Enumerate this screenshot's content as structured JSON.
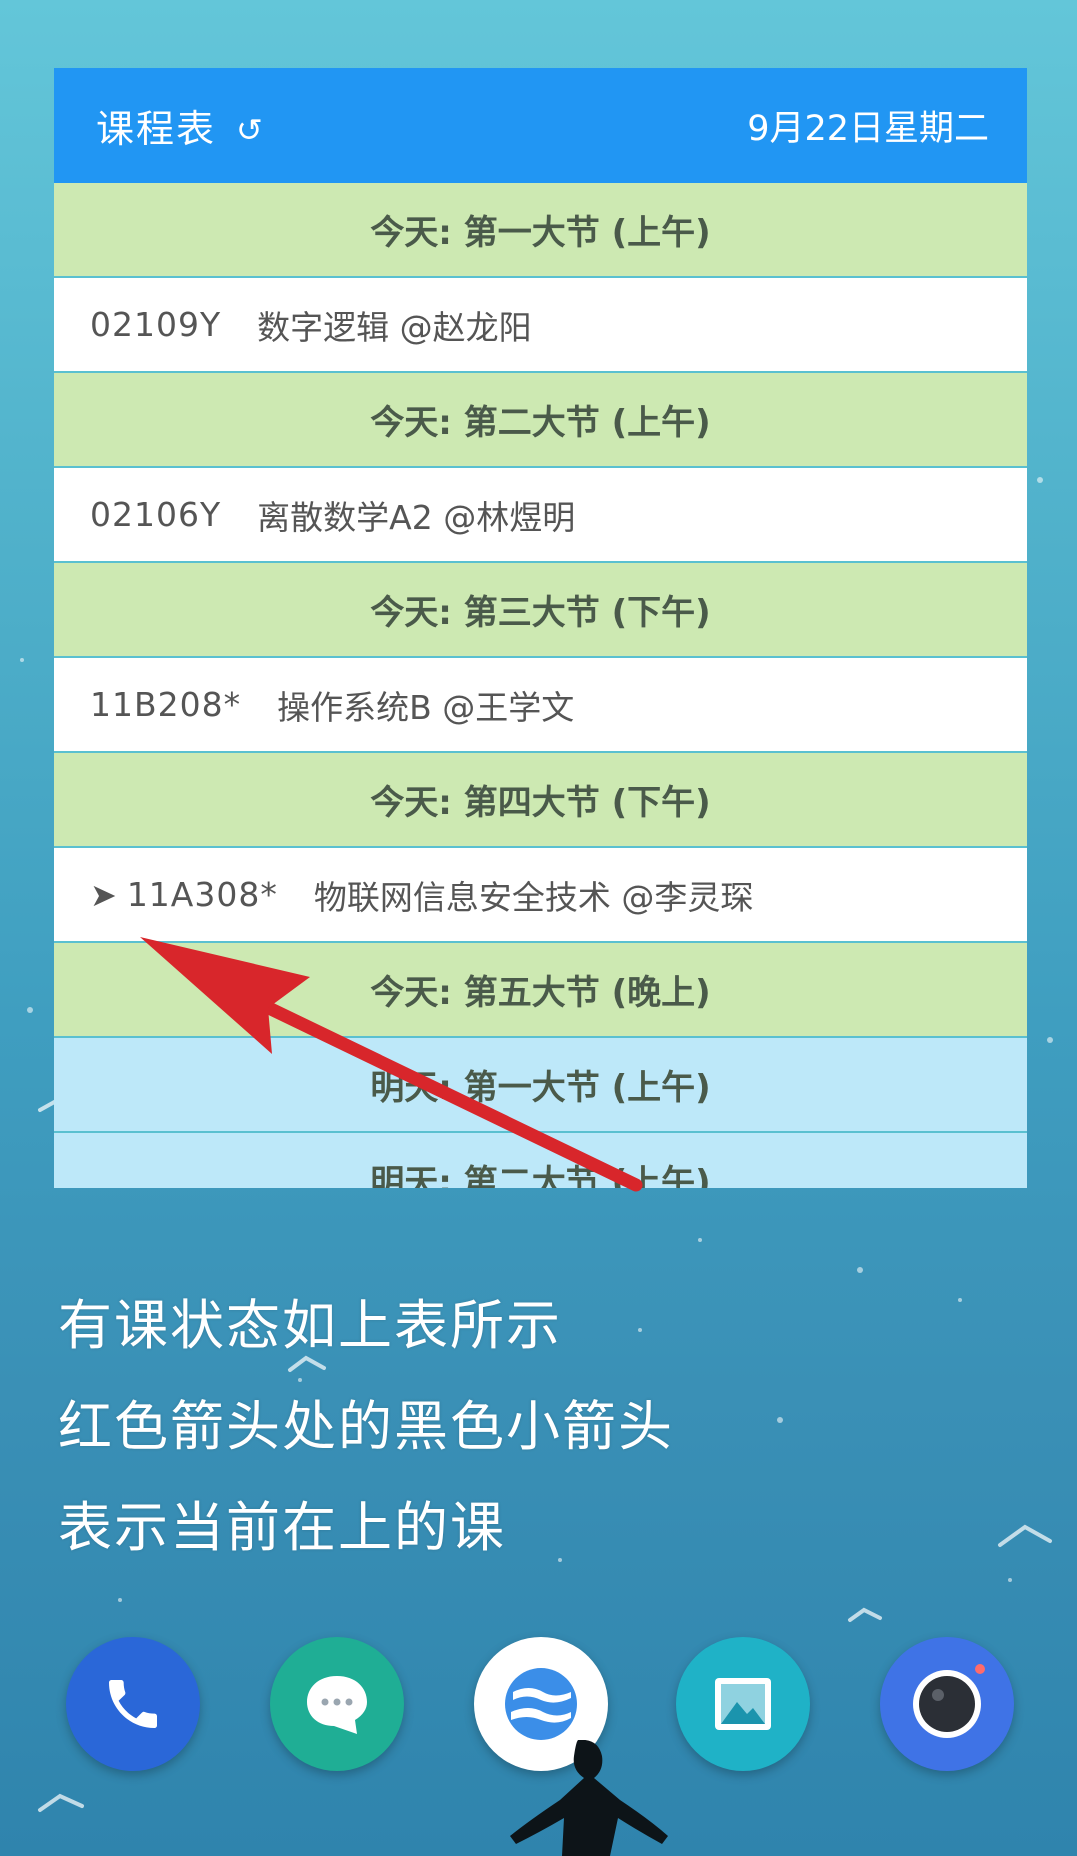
{
  "widget": {
    "title": "课程表",
    "refresh_glyph": "↺",
    "date": "9月22日星期二"
  },
  "rows": [
    {
      "type": "section",
      "label": "今天: 第一大节 (上午)"
    },
    {
      "type": "course",
      "code": "02109Y",
      "name": "数字逻辑 @赵龙阳"
    },
    {
      "type": "section",
      "label": "今天: 第二大节 (上午)"
    },
    {
      "type": "course",
      "code": "02106Y",
      "name": "离散数学A2 @林煜明"
    },
    {
      "type": "section",
      "label": "今天: 第三大节 (下午)"
    },
    {
      "type": "course",
      "code": "11B208*",
      "name": "操作系统B @王学文"
    },
    {
      "type": "section",
      "label": "今天: 第四大节 (下午)"
    },
    {
      "type": "course",
      "code": "11A308*",
      "name": "物联网信息安全技术 @李灵琛",
      "current": true,
      "current_glyph": "➤"
    },
    {
      "type": "section",
      "label": "今天: 第五大节 (晚上)"
    },
    {
      "type": "section_tomorrow",
      "label": "明天: 第一大节 (上午)"
    },
    {
      "type": "section_tomorrow",
      "label": "明天: 第二大节 (上午)"
    }
  ],
  "caption": {
    "line1": "有课状态如上表所示",
    "line2": "红色箭头处的黑色小箭头",
    "line3": "表示当前在上的课"
  },
  "dock": {
    "apps": [
      {
        "name": "phone-app",
        "icon": "phone-icon",
        "color": "#2a67d8"
      },
      {
        "name": "messages-app",
        "icon": "chat-bubble-icon",
        "color": "#1fae95"
      },
      {
        "name": "browser-app",
        "icon": "browser-icon",
        "color": "#ffffff"
      },
      {
        "name": "gallery-app",
        "icon": "image-icon",
        "color": "#1fb2c7"
      },
      {
        "name": "camera-app",
        "icon": "camera-icon",
        "color": "#3f73e6"
      }
    ]
  },
  "colors": {
    "header": "#2196f3",
    "today_section": "#cde9b2",
    "tomorrow_section": "#bde8f9",
    "annotation_arrow": "#d8262b"
  }
}
